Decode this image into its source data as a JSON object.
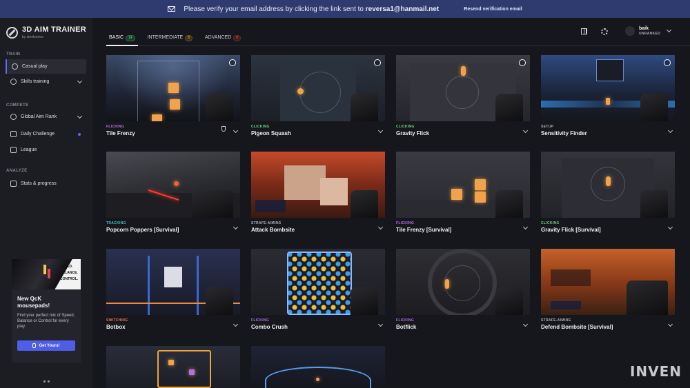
{
  "banner": {
    "message": "Please verify your email address by clicking the link sent to",
    "email": "reversa1@hanmail.net",
    "resend": "Resend verification email"
  },
  "app": {
    "title": "3D AIM TRAINER",
    "subtitle": "by steelseries"
  },
  "sidebar": {
    "sections": {
      "train": "TRAIN",
      "compete": "COMPETE",
      "analyze": "ANALYZE"
    },
    "items": [
      {
        "label": "Casual play",
        "icon": "crosshair-icon"
      },
      {
        "label": "Skills training",
        "icon": "target-icon"
      },
      {
        "label": "Global Aim Rank",
        "icon": "globe-icon"
      },
      {
        "label": "Daily Challenge",
        "icon": "calendar-icon"
      },
      {
        "label": "League",
        "icon": "shield-icon"
      },
      {
        "label": "Stats & progress",
        "icon": "chart-icon"
      }
    ]
  },
  "promo": {
    "image_text": [
      "SPEED.",
      "BALANCE.",
      "CONTROL."
    ],
    "title": "New QcK mousepads!",
    "body": "Find your perfect mix of Speed, Balance or Control for every play.",
    "button": "Get Yours!"
  },
  "tabs": [
    {
      "label": "BASIC",
      "count": "14"
    },
    {
      "label": "INTERMEDIATE",
      "count": "8"
    },
    {
      "label": "ADVANCED",
      "count": "8"
    }
  ],
  "user": {
    "name": "baik",
    "rank": "UNRANKED"
  },
  "cards": [
    {
      "category": "FLICKING",
      "name": "Tile Frenzy"
    },
    {
      "category": "CLICKING",
      "name": "Pigeon Squash"
    },
    {
      "category": "CLICKING",
      "name": "Gravity Flick"
    },
    {
      "category": "SETUP",
      "name": "Sensitivity Finder"
    },
    {
      "category": "TRACKING",
      "name": "Popcorn Poppers [Survival]"
    },
    {
      "category": "STRAFE-AIMING",
      "name": "Attack Bombsite"
    },
    {
      "category": "FLICKING",
      "name": "Tile Frenzy [Survival]"
    },
    {
      "category": "CLICKING",
      "name": "Gravity Flick [Survival]"
    },
    {
      "category": "SWITCHING",
      "name": "Botbox"
    },
    {
      "category": "FLICKING",
      "name": "Combo Crush"
    },
    {
      "category": "FLICKING",
      "name": "Botflick"
    },
    {
      "category": "STRAFE-AIMING",
      "name": "Defend Bombsite [Survival]"
    }
  ],
  "watermark": "INVEN",
  "colors": {
    "accent": "#5b6cf0",
    "banner": "#2f3b6e",
    "flicking": "#b66ee8",
    "clicking": "#6ed17a",
    "tracking": "#3dc4c8",
    "switching": "#f0724a"
  }
}
